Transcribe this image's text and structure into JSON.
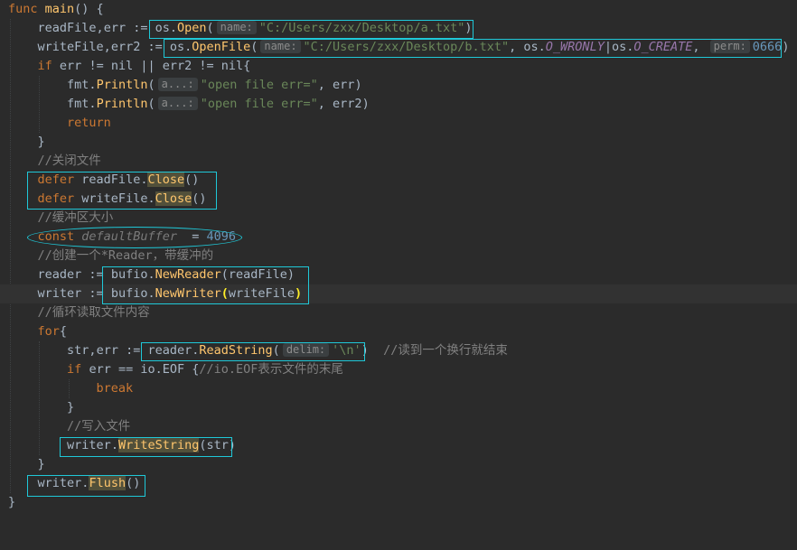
{
  "lines": [
    "func main() {",
    "readFile,err := os.Open(",
    "writeFile,err2 := os.OpenFile(",
    "if err != nil || err2 != nil{",
    "fmt.Println(",
    "fmt.Println(",
    "return",
    "}",
    "//关闭文件",
    "defer readFile.Close()",
    "defer writeFile.Close()",
    "//缓冲区大小",
    "const defaultBuffer  = 4096",
    "//创建一个*Reader，带缓冲的",
    "reader := bufio.NewReader(readFile)",
    "writer := bufio.NewWriter(writeFile)",
    "//循环读取文件内容",
    "for{",
    "str,err := reader.ReadString(",
    "if err == io.EOF {//io.EOF表示文件的末尾",
    "break",
    "}",
    "//写入文件",
    "writer.WriteString(str)",
    "}",
    "writer.Flush()",
    "}"
  ],
  "tokens": {
    "func": "func",
    "main": "main",
    "parens_open": "() {",
    "readFile": "readFile",
    "err": "err",
    "err2": "err2",
    "writeFile": "writeFile",
    "assign": " := ",
    "comma": ",",
    "os": "os",
    "dot": ".",
    "Open": "Open",
    "OpenFile": "OpenFile",
    "hint_name": "name:",
    "hint_perm": "perm:",
    "hint_a": "a...:",
    "hint_delim": "delim:",
    "path_a": "\"C:/Users/zxx/Desktop/a.txt\"",
    "path_b": "\"C:/Users/zxx/Desktop/b.txt\"",
    "O_WRONLY": "O_WRONLY",
    "O_CREATE": "O_CREATE",
    "perm_val": "0666",
    "if": "if",
    "neq_nil_or": " != nil || ",
    "neq_nil": " != nil",
    "fmt": "fmt",
    "Println": "Println",
    "open_file_err": "\"open file err=\"",
    "return": "return",
    "comment_close": "//关闭文件",
    "defer": "defer",
    "Close": "Close",
    "comment_buffer": "//缓冲区大小",
    "const": "const",
    "defaultBuffer": "defaultBuffer",
    "eq": "  = ",
    "buf_val": "4096",
    "comment_reader": "//创建一个*Reader，带缓冲的",
    "reader": "reader",
    "writer": "writer",
    "bufio": "bufio",
    "NewReader": "NewReader",
    "NewWriter": "NewWriter",
    "comment_loop": "//循环读取文件内容",
    "for": "for",
    "str": "str",
    "ReadString": "ReadString",
    "newline_char": "'\\n'",
    "comment_readline": "//读到一个换行就结束",
    "eq_eq": " == ",
    "io": "io",
    "EOF": "EOF",
    "comment_eof": "//io.EOF表示文件的末尾",
    "break": "break",
    "comment_write": "//写入文件",
    "WriteString": "WriteString",
    "Flush": "Flush"
  },
  "colors": {
    "background": "#2b2b2b",
    "keyword": "#cc7832",
    "function": "#ffc66d",
    "string": "#6a8759",
    "number": "#6897bb",
    "comment": "#808080",
    "constant": "#9876aa",
    "annotation_box": "#1fc8d8"
  }
}
